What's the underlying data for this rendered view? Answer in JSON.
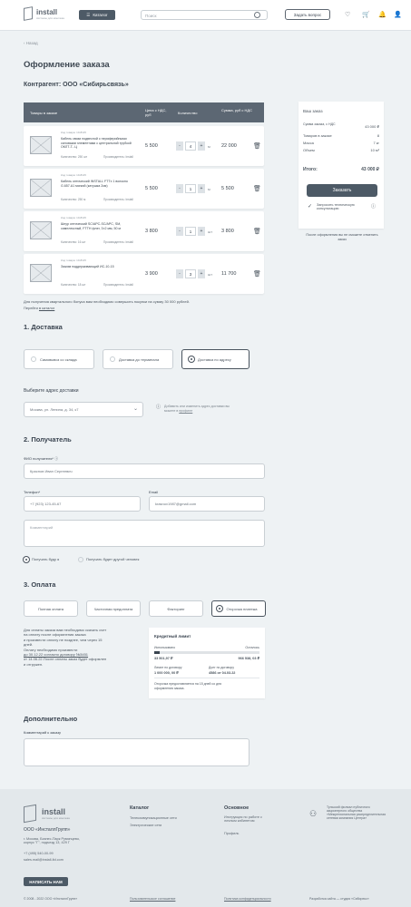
{
  "header": {
    "logo_text": "install",
    "logo_sub": "системы для монтажа",
    "catalog_label": "Каталог",
    "search_placeholder": "Поиск",
    "ask_label": "Задать вопрос"
  },
  "breadcrumb": "Назад",
  "page_title": "Оформление заказа",
  "contractor": "Контрагент: ООО «Сибирьсвязь»",
  "table": {
    "col_products": "Товары в заказе",
    "col_price": "Цена с НДС, руб",
    "col_qty": "Количество",
    "col_sum": "Сумма, руб с НДС"
  },
  "items": [
    {
      "art": "Код товара: 10-8115",
      "name": "Кабель связи подвесной с периферийными силовыми элементами с центральной трубкой ОКЛТ-Т...Ц",
      "stock": "Количество: 250 шт",
      "maker": "Производитель: Install",
      "price": "5 500",
      "qty": "4",
      "unit": "м",
      "total": "22 000"
    },
    {
      "art": "Код товара: 10-8115",
      "name": "Кабель оптический INSTALL FTTx 1 волокно G.657.A1 мягкий (катушка 2км)",
      "stock": "Количество: 250 м",
      "maker": "Производитель: Install",
      "price": "5 500",
      "qty": "1",
      "unit": "м",
      "total": "5 500"
    },
    {
      "art": "Код товара: 10-8115",
      "name": "Шнур оптический SC/APC-SC/APC, SM, симплексный, FTTH флэт, 3×2 мм, 50 м",
      "stock": "Количество: 16 шт",
      "maker": "Производитель: Install",
      "price": "3 800",
      "qty": "1",
      "unit": "шт",
      "total": "3 800"
    },
    {
      "art": "Код товара: 10-8115",
      "name": "Зажим поддерживающий ИС-10-15",
      "stock": "Количество: 18 шт",
      "maker": "Производитель: Install",
      "price": "3 900",
      "qty": "3",
      "unit": "шт",
      "total": "11 700"
    }
  ],
  "bonus_text": "Для получения квартального бонуса вам необходимо совершить покупки на сумму 30 000 рублей.",
  "bonus_link_prefix": "Перейти",
  "bonus_link": "в каталог",
  "summary": {
    "title": "Ваш заказ",
    "sum_label": "Сумма заказа, с НДС",
    "sum_value": "43 000 ₽",
    "count_label": "Товаров в заказе",
    "count_value": "8",
    "mass_label": "Масса",
    "mass_value": "7 кг",
    "volume_label": "Объем",
    "volume_value": "10 м³",
    "total_label": "Итого:",
    "total_value": "43 000 ₽",
    "order_btn": "Заказать",
    "consult_label": "Запросить техническую консультацию",
    "note": "После оформления вы не сможете отменить заказ"
  },
  "delivery": {
    "title": "1. Доставка",
    "options": [
      "Самовывоз со склада",
      "Доставка до терминала",
      "Доставка по адресу"
    ],
    "selected": 2,
    "address_label": "Выберите адрес доставки",
    "address_value": "Москва, ул. Ленина, д. 34, к7",
    "address_hint": "Добавить или изменить адрес доставки вы можете в",
    "address_hint_link": "профиле"
  },
  "recipient": {
    "title": "2. Получатель",
    "fio_label": "ФИО получателя*",
    "fio_value": "Краснов Иван Сергеевич",
    "phone_label": "Телефон*",
    "phone_value": "+7 (923) 123-45-67",
    "email_label": "Email",
    "email_value": "krasnov1987@gmail.com",
    "comment_placeholder": "Комментарий",
    "opt1": "Получать буду я",
    "opt2": "Получать будет другой человек"
  },
  "payment": {
    "title": "3. Оплата",
    "options": [
      "Полная оплата",
      "Частичная предоплата",
      "Факторинг",
      "Отсрочка платежа"
    ],
    "selected": 3,
    "info_lines": [
      "Для оплаты заказа вам необходимо скачать счет",
      "на оплату после оформления заказа",
      "и произвести оплату не позднее, чем через 15",
      "дней.",
      "Оплату необходимо произвести",
      "до 30.12.22 согласно договору №3451",
      "от 14.06.22.После оплаты заказ будет оформлен",
      "и отгружен."
    ],
    "credit_title": "Кредитный лимит",
    "used_label": "Использовано",
    "left_label": "Осталось",
    "used_value": "33 501,97 ₽",
    "left_value": "966 538, 03 ₽",
    "limit_label": "Лимит по договору",
    "limit_value": "1 000 000, 00 ₽",
    "debt_label": "Долг по договору",
    "debt_value": "4586 от 04.03.22",
    "credit_note": "Отсрочка предоставляется на 15 дней со дня оформления заказа.",
    "used_fraction": 0.034
  },
  "extra": {
    "title": "Дополнительно",
    "comment_label": "Комментарий к заказу"
  },
  "footer": {
    "company": "ООО «ИнсталлГрупп»",
    "address": "г. Москва, Бизнес-Парк Румянцево, корпус \"Г\", подъезд 13, 429 Г",
    "phone": "+7 (495) 540-00-99",
    "email": "sales.mail@install-ltd.com",
    "write_btn": "НАПИСАТЬ НАМ",
    "catalog_title": "Каталог",
    "catalog_links": [
      "Телекоммуникационные сети",
      "Электрические сети"
    ],
    "main_title": "Основное",
    "main_links": [
      "Инструкция по работе с личным кабинетом",
      "Профиль"
    ],
    "member_text": "Тульский филиал публичного акционерного общества «Межрегиональная распределительная сетевая компания Центра»",
    "copyright": "© 2008 - 2022 ООО «ИнсталлГрупп»",
    "agreement": "Пользовательское соглашение",
    "privacy": "Политика конфиденциальности",
    "dev": "Разработка сайта — студия «Сибирекс»"
  }
}
